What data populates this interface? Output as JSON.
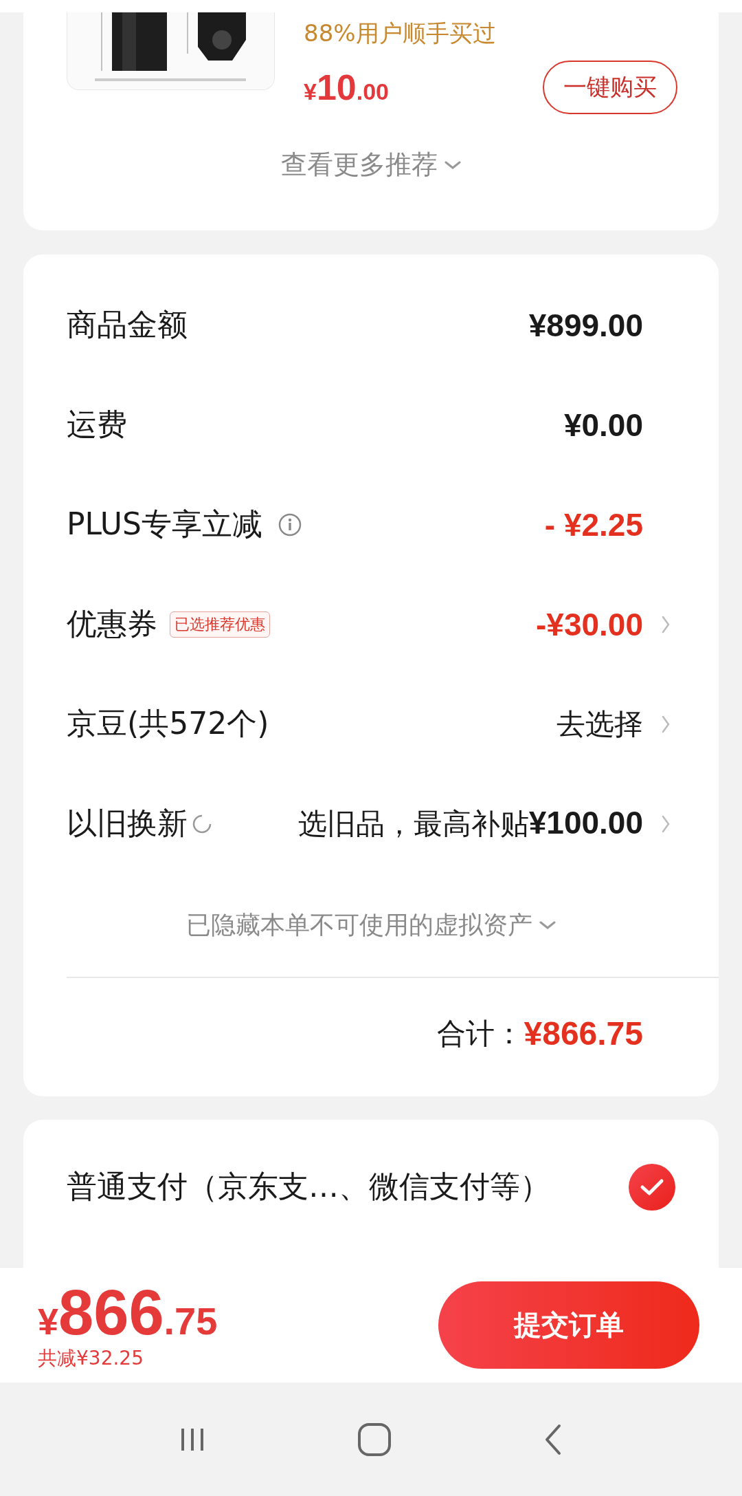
{
  "recommendation": {
    "product": {
      "kind": "picture",
      "note": "88%用户顺手买过",
      "price_symbol": "¥",
      "price_integer": "10",
      "price_decimal": ".00",
      "buy_button": "一键购买"
    },
    "more_link": "查看更多推荐"
  },
  "summary": {
    "rows": [
      {
        "label": "商品金额",
        "value": "¥899.00",
        "kind": "amount",
        "info": false,
        "chevron": false
      },
      {
        "label": "运费",
        "value": "¥0.00",
        "kind": "amount",
        "info": false,
        "chevron": false
      },
      {
        "label": "PLUS专享立减",
        "value": "- ¥2.25",
        "kind": "discount",
        "info": true,
        "chevron": false
      },
      {
        "label": "优惠券",
        "tag": "已选推荐优惠",
        "value": "-¥30.00",
        "kind": "discount",
        "info": false,
        "chevron": true
      },
      {
        "label": "京豆(共572个)",
        "value": "去选择",
        "kind": "plain",
        "info": false,
        "chevron": true
      },
      {
        "label": "以旧换新",
        "value": "选旧品，最高补贴**¥100.00**",
        "kind": "plain",
        "info": false,
        "chevron": true,
        "spinner": true
      }
    ],
    "hidden_note": "已隐藏本单不可使用的虚拟资产",
    "total_label": "合计：",
    "total_value": "¥866.75"
  },
  "payment": {
    "options": [
      {
        "label": "普通支付（京东支…、微信支付等）",
        "selected": true
      }
    ]
  },
  "bottom_bar": {
    "price_symbol": "¥",
    "price_integer": "866",
    "price_decimal": ".75",
    "saving": "共减¥32.25",
    "submit_button": "提交订单"
  }
}
